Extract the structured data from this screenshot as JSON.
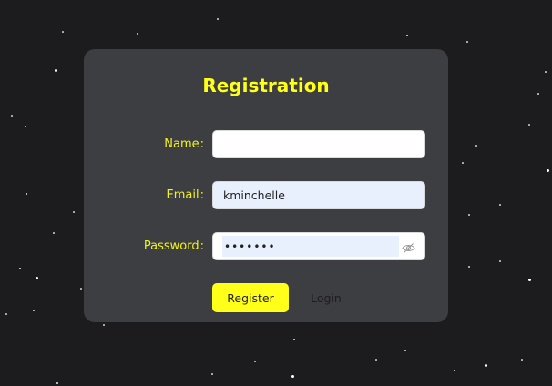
{
  "form": {
    "title": "Registration",
    "name_label": "Name",
    "email_label": "Email",
    "password_label": "Password",
    "colon": ":",
    "name_value": "",
    "email_value": "kminchelle",
    "password_value": "•••••••"
  },
  "actions": {
    "register_label": "Register",
    "login_label": "Login"
  },
  "icons": {
    "password_toggle": "eye-slash-icon"
  },
  "colors": {
    "accent": "#ffff1a",
    "card": "#3d3e42",
    "background": "#1c1c1e",
    "autofill": "#e8f0fe"
  }
}
